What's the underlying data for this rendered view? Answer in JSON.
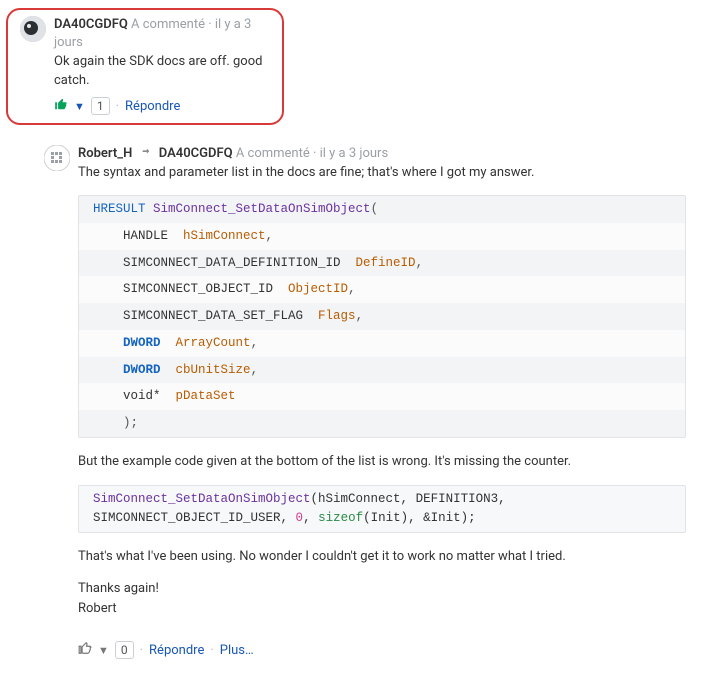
{
  "comment1": {
    "author": "DA40CGDFQ",
    "meta": "A commenté · il y a 3 jours",
    "body": "Ok again the SDK docs are off. good catch.",
    "vote_count": "1",
    "reply": "Répondre"
  },
  "comment2": {
    "author": "Robert_H",
    "reply_to": "DA40CGDFQ",
    "meta": "A commenté · il y a 3 jours",
    "intro": "The syntax and parameter list in the docs are fine; that's where I got my answer.",
    "code1": {
      "l1_a": "HRESULT ",
      "l1_b": "SimConnect_SetDataOnSimObject",
      "l1_c": "(",
      "l2_a": "    HANDLE  ",
      "l2_b": "hSimConnect",
      "l2_c": ",",
      "l3_a": "    SIMCONNECT_DATA_DEFINITION_ID  ",
      "l3_b": "DefineID",
      "l3_c": ",",
      "l4_a": "    SIMCONNECT_OBJECT_ID  ",
      "l4_b": "ObjectID",
      "l4_c": ",",
      "l5_a": "    SIMCONNECT_DATA_SET_FLAG  ",
      "l5_b": "Flags",
      "l5_c": ",",
      "l6_a": "    ",
      "l6_b": "DWORD",
      "l6_c": "  ",
      "l6_d": "ArrayCount",
      "l6_e": ",",
      "l7_a": "    ",
      "l7_b": "DWORD",
      "l7_c": "  ",
      "l7_d": "cbUnitSize",
      "l7_e": ",",
      "l8_a": "    void*  ",
      "l8_b": "pDataSet",
      "l9_a": "    );"
    },
    "para2": "But the example code given at the bottom of the list is wrong. It's missing the counter.",
    "code2": {
      "l1_a": "SimConnect_SetDataOnSimObject",
      "l1_b": "(hSimConnect, DEFINITION3, SIMCONNECT_OBJECT_ID_USER, ",
      "l2_a": "0",
      "l2_b": ", ",
      "l2_c": "sizeof",
      "l2_d": "(Init), &Init);"
    },
    "para3": "That's what I've been using. No wonder I couldn't get it to work no matter what I tried.",
    "para4": "Thanks again!",
    "para5": "Robert",
    "vote_count": "0",
    "reply": "Répondre",
    "more": "Plus…"
  }
}
